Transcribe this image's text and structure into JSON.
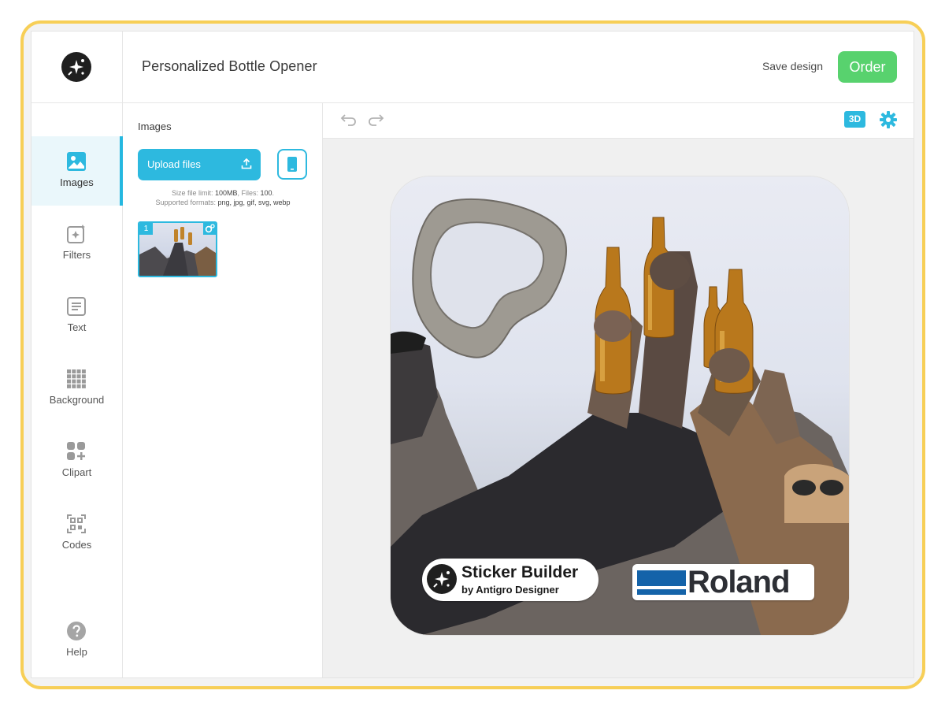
{
  "header": {
    "title": "Personalized Bottle Opener",
    "save_label": "Save design",
    "order_label": "Order"
  },
  "nav": {
    "items": [
      {
        "label": "Images",
        "icon": "image-icon",
        "active": true
      },
      {
        "label": "Filters",
        "icon": "sparkle-icon",
        "active": false
      },
      {
        "label": "Text",
        "icon": "text-icon",
        "active": false
      },
      {
        "label": "Background",
        "icon": "grid-icon",
        "active": false
      },
      {
        "label": "Clipart",
        "icon": "clipart-icon",
        "active": false
      },
      {
        "label": "Codes",
        "icon": "qr-code-icon",
        "active": false
      }
    ],
    "help_label": "Help"
  },
  "panel": {
    "title": "Images",
    "upload_label": "Upload files",
    "limit_prefix": "Size file limit: ",
    "limit_size": "100MB",
    "limit_files_prefix": ", Files: ",
    "limit_files": "100",
    "limit_suffix": ".",
    "formats_prefix": "Supported formats: ",
    "formats": "png, jpg, gif, svg, webp",
    "thumbnail_badge": "1"
  },
  "toolbar": {
    "view_3d_label": "3D"
  },
  "canvas": {
    "sticker_title": "Sticker Builder",
    "sticker_subtitle": "by Antigro Designer",
    "brand_logo_text": "Roland"
  },
  "colors": {
    "accent": "#2db9df",
    "order_green": "#58d26e",
    "frame_yellow": "#f7cf57",
    "roland_blue": "#1463a9"
  }
}
